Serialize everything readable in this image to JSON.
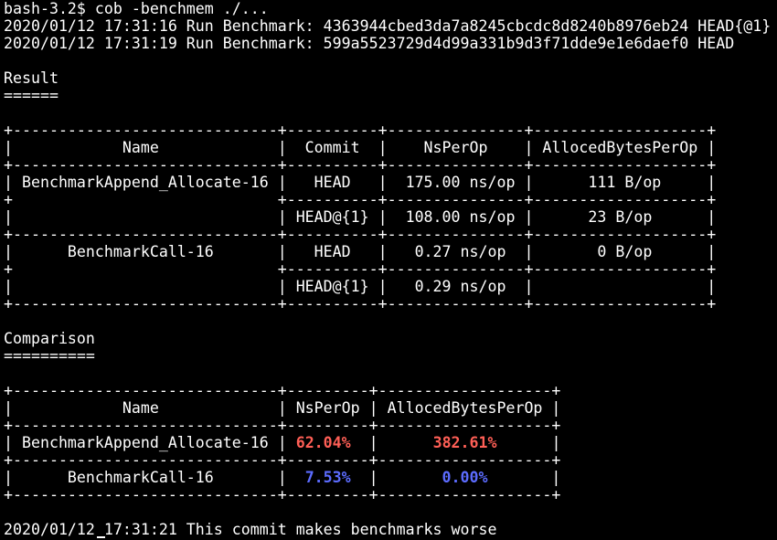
{
  "prompt": "bash-3.2$ cob -benchmem ./...",
  "log_lines": [
    "2020/01/12 17:31:16 Run Benchmark: 4363944cbed3da7a8245cbcdc8d8240b8976eb24 HEAD{@1}",
    "2020/01/12 17:31:19 Run Benchmark: 599a5523729d4d99a331b9d3f71dde9e1e6daef0 HEAD"
  ],
  "result": {
    "title": "Result",
    "underline": "======",
    "border_top": "+-----------------------------+----------+---------------+-------------------+",
    "header": "|            Name             |  Commit  |    NsPerOp    | AllocedBytesPerOp |",
    "border_mid": "+-----------------------------+----------+---------------+-------------------+",
    "rows": [
      "| BenchmarkAppend_Allocate-16 |   HEAD   |  175.00 ns/op |      111 B/op     |",
      "+                             +----------+---------------+-------------------+",
      "|                             | HEAD@{1} |  108.00 ns/op |      23 B/op      |",
      "+-----------------------------+----------+---------------+-------------------+",
      "|      BenchmarkCall-16       |   HEAD   |   0.27 ns/op  |       0 B/op      |",
      "+                             +----------+---------------+-------------------+",
      "|                             | HEAD@{1} |   0.29 ns/op  |                   |",
      "+-----------------------------+----------+---------------+-------------------+"
    ]
  },
  "comparison": {
    "title": "Comparison",
    "underline": "==========",
    "border_top": "+-----------------------------+---------+-------------------+",
    "header": "|            Name             | NsPerOp | AllocedBytesPerOp |",
    "border_mid": "+-----------------------------+---------+-------------------+",
    "row1_prefix": "| BenchmarkAppend_Allocate-16 | ",
    "row1_ns": "62.04%",
    "row1_mid": "  |      ",
    "row1_alloc": "382.61%",
    "row1_suffix": "      |",
    "border_row": "+-----------------------------+---------+-------------------+",
    "row2_prefix": "|      BenchmarkCall-16       |  ",
    "row2_ns": "7.53%",
    "row2_mid": "  |       ",
    "row2_alloc": "0.00%",
    "row2_suffix": "       |",
    "border_bottom": "+-----------------------------+---------+-------------------+"
  },
  "final_message": "2020/01/12 17:31:21 This commit makes benchmarks worse",
  "colors": {
    "background": "#000000",
    "foreground": "#ffffff",
    "worse": "#ff5f56",
    "better": "#5c6cff"
  }
}
